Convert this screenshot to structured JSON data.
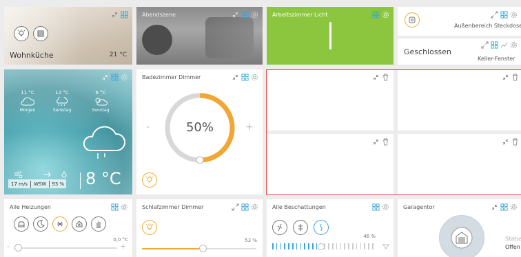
{
  "colors": {
    "accent_orange": "#f0a733",
    "green_tile": "#8cc63f",
    "selection_red": "#e44444",
    "blue_icon": "#3aa4df"
  },
  "wohnkueche": {
    "name": "Wohnküche",
    "temp": "21 °C"
  },
  "abendszene": {
    "title": "Abendszene"
  },
  "arbeitszimmer": {
    "title": "Arbeitszimmer Licht"
  },
  "aussen": {
    "title": "Außenbereich Steckdose"
  },
  "keller": {
    "status": "Geschlossen",
    "title": "Keller-Fenster"
  },
  "weather": {
    "forecast": [
      {
        "temp": "11 °C",
        "day": "Morgen",
        "icon": "cloud-icon"
      },
      {
        "temp": "12 °C",
        "day": "Samstag",
        "icon": "rain-cloud-icon"
      },
      {
        "temp": "6 °C",
        "day": "Sonntag",
        "icon": "sun-cloud-icon"
      }
    ],
    "wind_speed": "17 m/s",
    "wind_dir": "WSW",
    "humidity": "93 %",
    "current_temp": "8 °C"
  },
  "badezimmer": {
    "title": "Badezimmer Dimmer",
    "percent": "50%",
    "level": 0.5,
    "minus": "-",
    "plus": "+"
  },
  "heizungen": {
    "title": "Alle Heizungen",
    "temp": "0,0 °C",
    "minus": "-",
    "plus": "+"
  },
  "schlafzimmer": {
    "title": "Schlafzimmer Dimmer",
    "percent": "53 %",
    "level": 0.53
  },
  "beschattungen": {
    "title": "Alle Beschattungen",
    "percent": "46 %",
    "level": 0.46
  },
  "garagentor": {
    "title": "Garagentor",
    "status_label": "Status",
    "status_value": "Offen"
  }
}
